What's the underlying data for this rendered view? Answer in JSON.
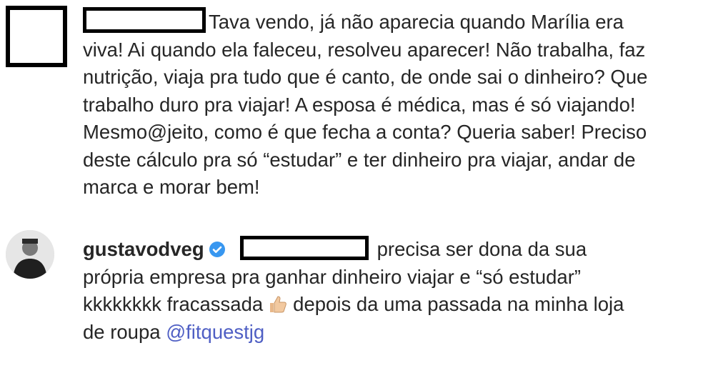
{
  "comment": {
    "text": "Tava vendo, já não aparecia quando Marília era viva! Ai quando ela faleceu, resolveu aparecer! Não trabalha, faz nutrição, viaja pra tudo que é canto, de onde sai o dinheiro? Que trabalho duro pra viajar! A esposa é médica, mas é só viajando! Mesmo@jeito, como é que fecha a conta? Queria saber! Preciso deste cálculo pra só “estudar” e ter dinheiro pra viajar, andar de marca e morar bem!"
  },
  "reply": {
    "username": "gustavodveg",
    "verified_icon": "verified-badge-icon",
    "text_before_emoji": "precisa ser dona da sua própria empresa pra ganhar dinheiro viajar e “só estudar” kkkkkkkk fracassada",
    "emoji_icon": "thumbs-up-icon",
    "text_after_emoji": "depois da uma passada na minha loja de roupa",
    "mention": "@fitquestjg"
  },
  "colors": {
    "text": "#262626",
    "mention": "#4f5fc4",
    "verified": "#3897f0",
    "redaction": "#000000"
  }
}
